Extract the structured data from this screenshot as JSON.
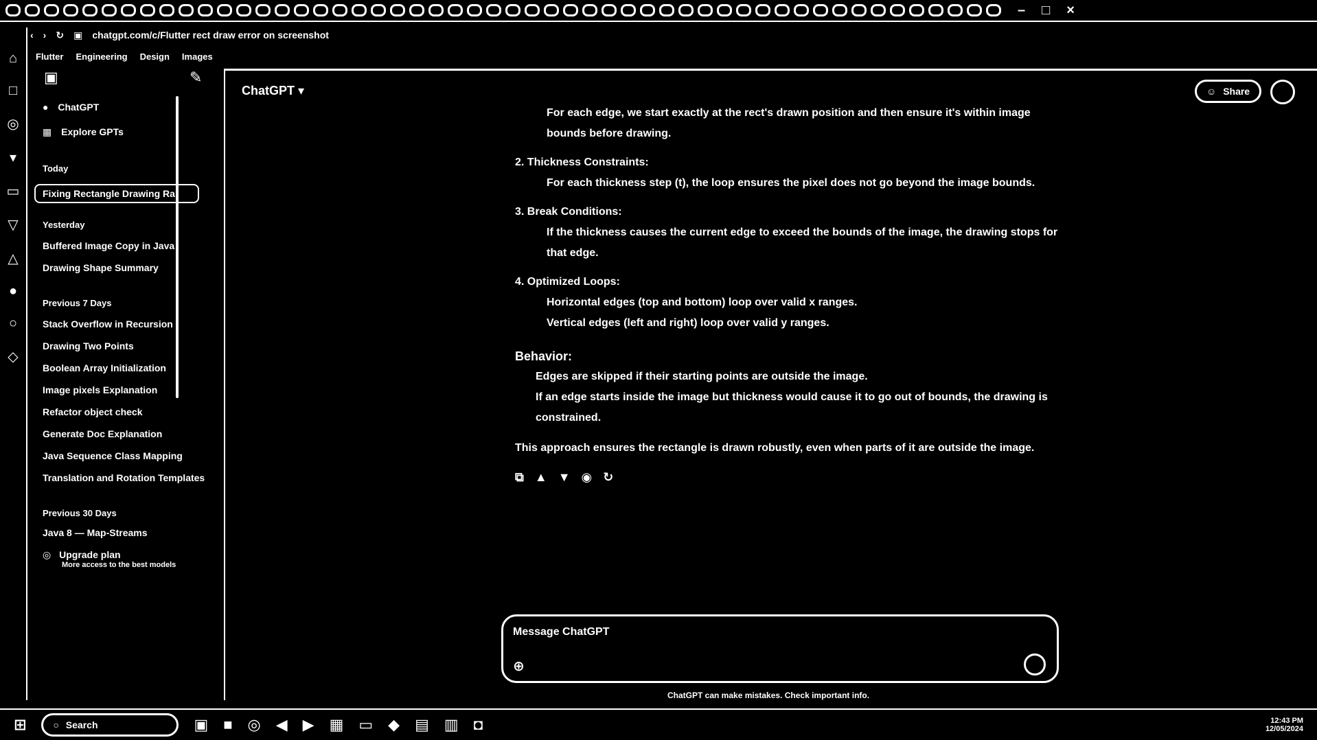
{
  "browser": {
    "tab_count": 52,
    "url": "chatgpt.com/c/Flutter rect draw error on screenshot",
    "bookmarks": [
      "Flutter",
      "Engineering",
      "Design",
      "Images"
    ],
    "window_controls": {
      "min": "–",
      "max": "□",
      "close": "×"
    }
  },
  "app": {
    "model_label": "ChatGPT",
    "share_label": "Share",
    "sidebar": {
      "nav": [
        {
          "label": "ChatGPT",
          "icon": "chatgpt-logo-icon"
        },
        {
          "label": "Explore GPTs",
          "icon": "grid-icon"
        }
      ],
      "sections": [
        {
          "heading": "Today",
          "items": [
            "Fixing Rectangle Drawing Ra"
          ]
        },
        {
          "heading": "Yesterday",
          "items": [
            "Buffered Image Copy in Java",
            "Drawing Shape Summary"
          ]
        },
        {
          "heading": "Previous 7 Days",
          "items": [
            "Stack Overflow in Recursion",
            "Drawing Two Points",
            "Boolean Array Initialization",
            "Image pixels Explanation",
            "Refactor object check",
            "Generate Doc Explanation",
            "Java Sequence Class Mapping",
            "Translation and Rotation Templates"
          ]
        },
        {
          "heading": "Previous 30 Days",
          "items": [
            "Java 8 — Map-Streams"
          ]
        }
      ],
      "upgrade": {
        "title": "Upgrade plan",
        "subtitle": "More access to the best models"
      }
    },
    "conversation": {
      "top_bullet": "For each edge, we start exactly at the rect's drawn position and then ensure it's within image bounds before drawing.",
      "items": [
        {
          "num": "2.",
          "title": "Thickness Constraints:",
          "bullets": [
            "For each thickness step (t), the loop ensures the pixel does not go beyond the image bounds."
          ]
        },
        {
          "num": "3.",
          "title": "Break Conditions:",
          "bullets": [
            "If the thickness causes the current edge to exceed the bounds of the image, the drawing stops for that edge."
          ]
        },
        {
          "num": "4.",
          "title": "Optimized Loops:",
          "bullets": [
            "Horizontal edges (top and bottom) loop over valid x ranges.",
            "Vertical edges (left and right) loop over valid y ranges."
          ]
        }
      ],
      "behavior_heading": "Behavior:",
      "behavior_bullets": [
        "Edges are skipped if their starting points are outside the image.",
        "If an edge starts inside the image but thickness would cause it to go out of bounds, the drawing is constrained."
      ],
      "summary": "This approach ensures the rectangle is drawn robustly, even when parts of it are outside the image.",
      "actions": [
        "copy-icon",
        "thumbs-up-icon",
        "thumbs-down-icon",
        "speaker-icon",
        "regenerate-icon"
      ]
    },
    "composer": {
      "placeholder": "Message ChatGPT",
      "disclaimer": "ChatGPT can make mistakes. Check important info."
    }
  },
  "taskbar": {
    "search_label": "Search",
    "clock": "12:43 PM",
    "date": "12/05/2024"
  }
}
